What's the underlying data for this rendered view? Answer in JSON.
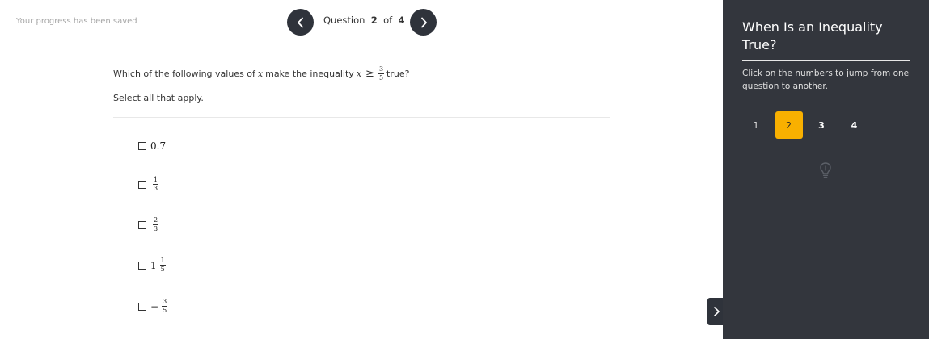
{
  "status": {
    "saved_text": "Your progress has been saved"
  },
  "navigation": {
    "question_word": "Question",
    "current": "2",
    "of_word": "of",
    "total": "4"
  },
  "question": {
    "prompt_before": "Which of the following values of",
    "variable": "x",
    "prompt_middle": "make the inequality",
    "operator": "≥",
    "threshold": {
      "numerator": "3",
      "denominator": "5"
    },
    "prompt_after": "true?",
    "instruction": "Select all that apply."
  },
  "options": [
    {
      "label": "0.7"
    },
    {
      "numerator": "1",
      "denominator": "3"
    },
    {
      "numerator": "2",
      "denominator": "3"
    },
    {
      "whole": "1",
      "numerator": "1",
      "denominator": "5"
    },
    {
      "sign": "−",
      "numerator": "3",
      "denominator": "5"
    }
  ],
  "sidebar": {
    "title": "When Is an Inequality True?",
    "help_text": "Click on the numbers to jump from one question to another.",
    "question_numbers": [
      "1",
      "2",
      "3",
      "4"
    ],
    "active_question": "2"
  },
  "icons": {
    "prev": "chevron-left-icon",
    "next": "chevron-right-icon",
    "hint": "lightbulb-icon",
    "expand": "chevron-right-icon"
  },
  "colors": {
    "sidebar_bg": "#33363d",
    "nav_button_bg": "#2f333b",
    "active_accent": "#f9b000"
  }
}
